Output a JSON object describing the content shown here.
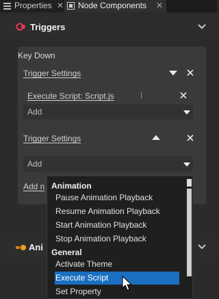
{
  "tabs": [
    {
      "label": "Properties",
      "close": "✕"
    },
    {
      "label": "Node Components",
      "close": "✕"
    }
  ],
  "triggers": {
    "title": "Triggers",
    "event": "Key Down",
    "groups": [
      {
        "label": "Trigger Settings",
        "expanded": true,
        "action": "Execute Script: Script.js",
        "add_label": "Add"
      },
      {
        "label": "Trigger Settings",
        "expanded": false,
        "add_label": "Add"
      }
    ],
    "add_new_label": "Add n"
  },
  "animation_section": {
    "title": "Ani"
  },
  "dropdown": {
    "groups": [
      {
        "heading": "Animation",
        "items": [
          "Pause Animation Playback",
          "Resume Animation Playback",
          "Start Animation Playback",
          "Stop Animation Playback"
        ]
      },
      {
        "heading": "General",
        "items": [
          "Activate Theme",
          "Execute Script",
          "Set Property"
        ]
      }
    ],
    "selected": "Execute Script"
  },
  "colors": {
    "accent": "#1a6fc0",
    "trigger_icon": "#e8384f",
    "anim_icon": "#f0a020"
  }
}
